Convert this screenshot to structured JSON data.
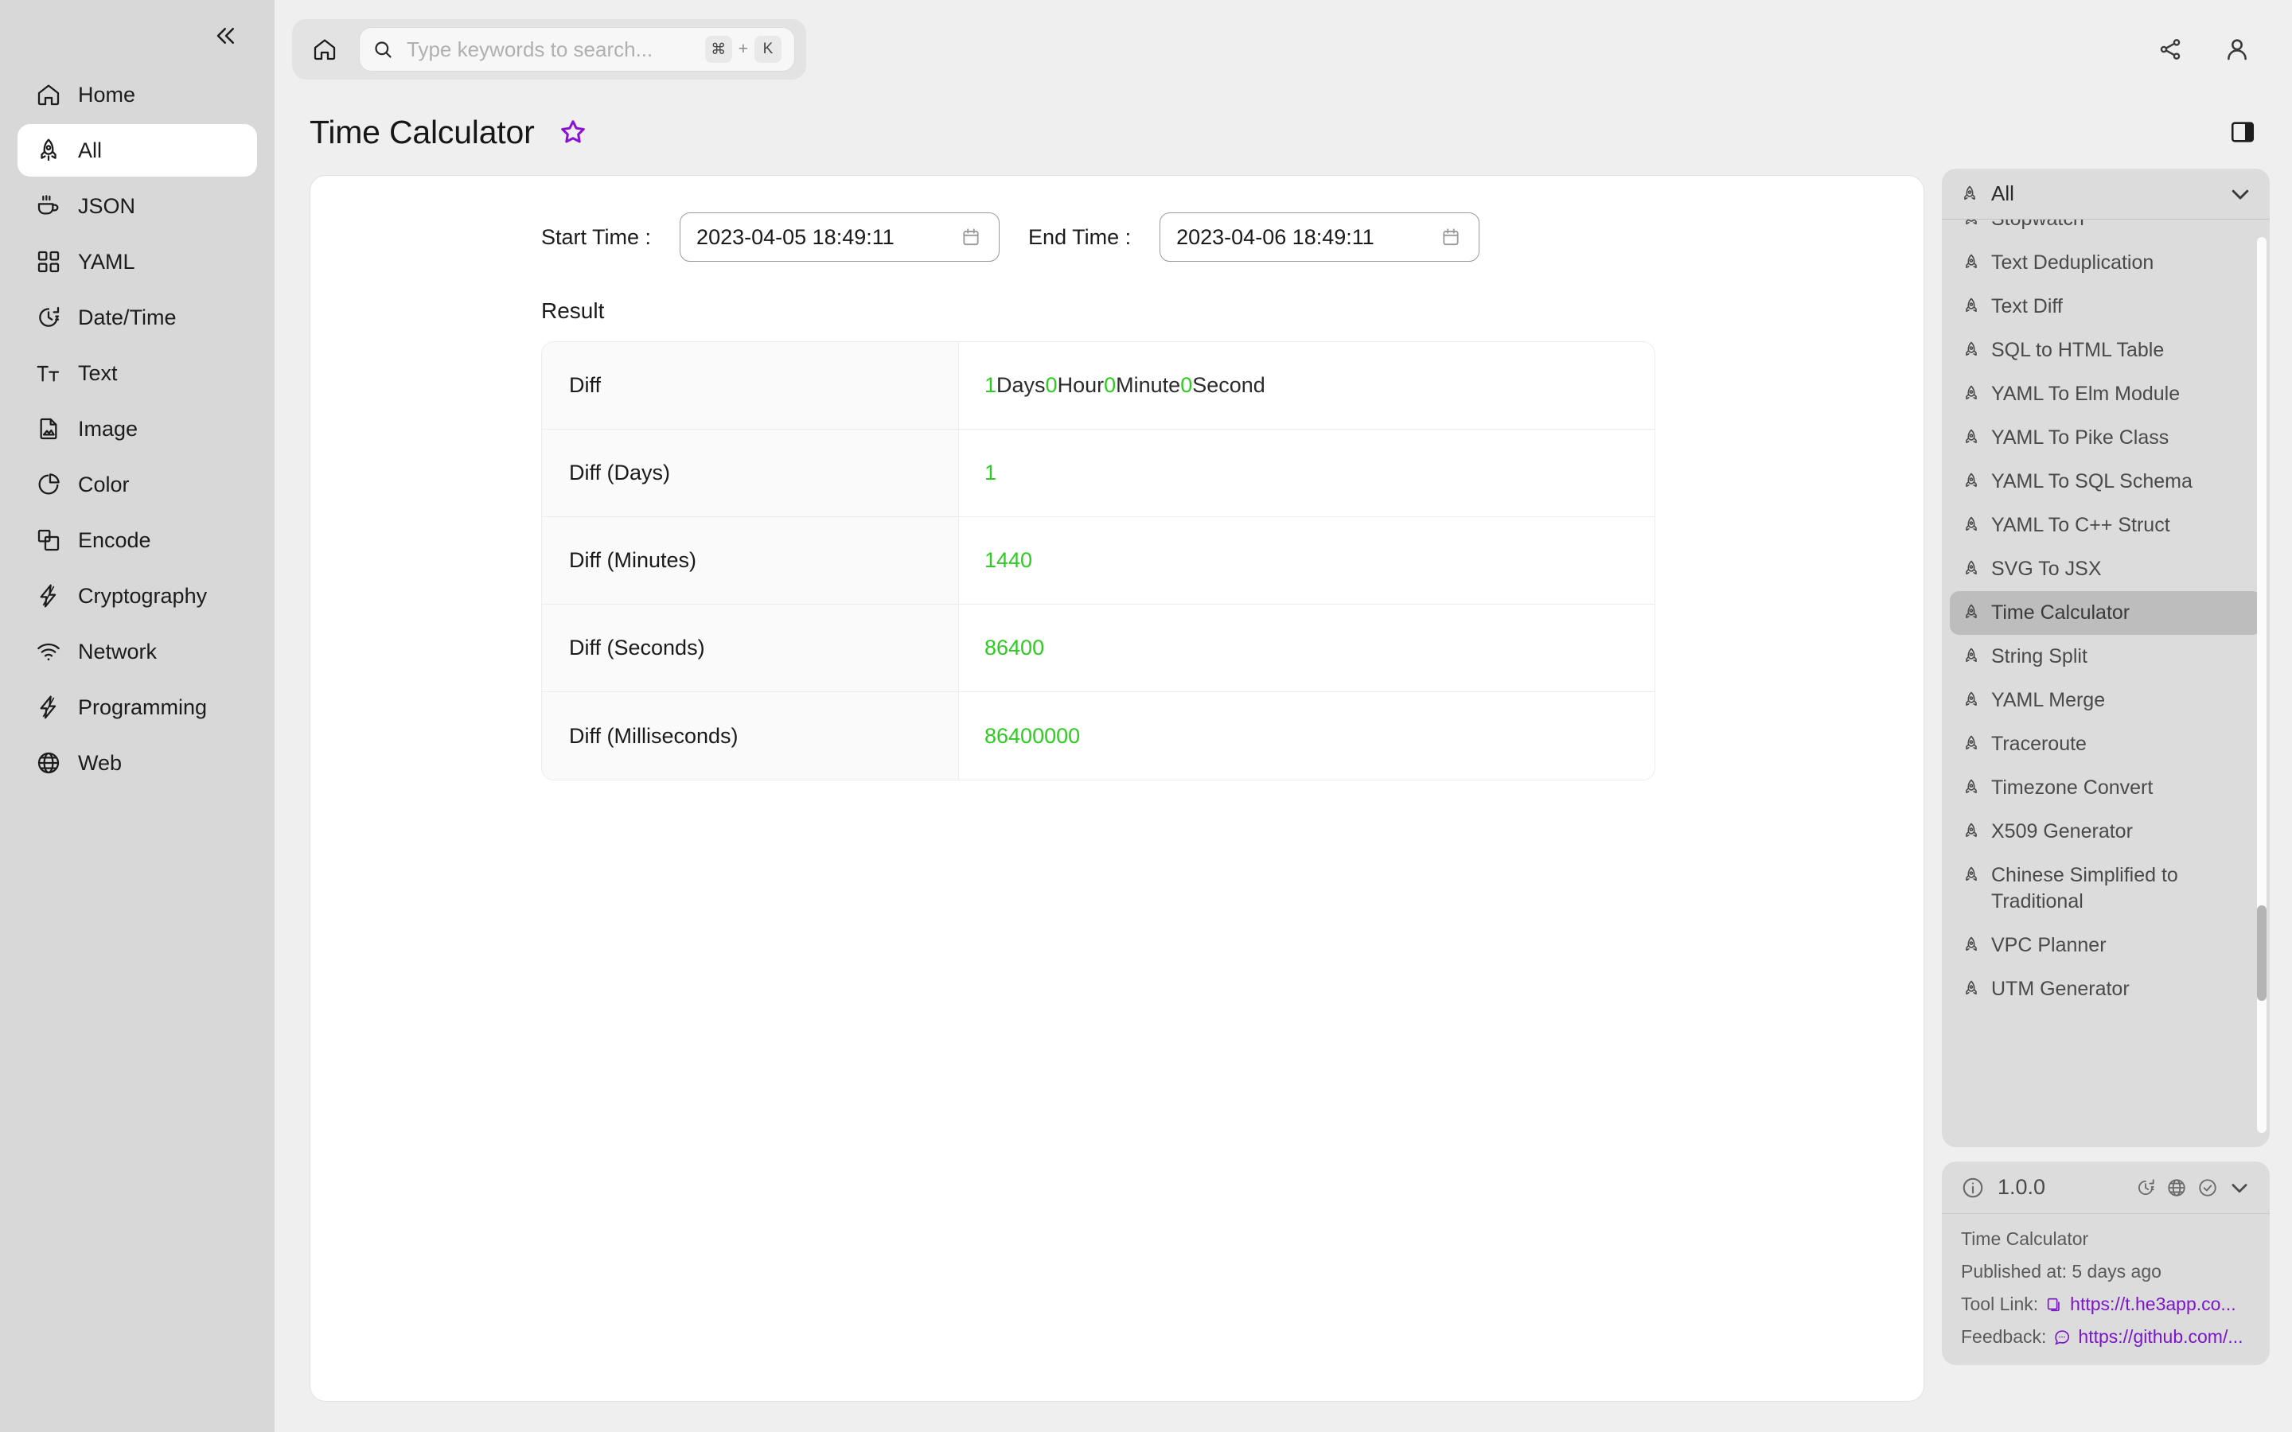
{
  "sidebar": {
    "collapse_icon": "chevron-double-left-icon",
    "items": [
      {
        "label": "Home",
        "icon": "home-icon",
        "active": false
      },
      {
        "label": "All",
        "icon": "rocket-icon",
        "active": true
      },
      {
        "label": "JSON",
        "icon": "coffee-cup-icon",
        "active": false
      },
      {
        "label": "YAML",
        "icon": "grid-squares-icon",
        "active": false
      },
      {
        "label": "Date/Time",
        "icon": "clock-arrow-icon",
        "active": false
      },
      {
        "label": "Text",
        "icon": "text-tt-icon",
        "active": false
      },
      {
        "label": "Image",
        "icon": "image-file-icon",
        "active": false
      },
      {
        "label": "Color",
        "icon": "pie-chart-icon",
        "active": false
      },
      {
        "label": "Encode",
        "icon": "layers-icon",
        "active": false
      },
      {
        "label": "Cryptography",
        "icon": "lightning-icon",
        "active": false
      },
      {
        "label": "Network",
        "icon": "wifi-icon",
        "active": false
      },
      {
        "label": "Programming",
        "icon": "lightning-icon",
        "active": false
      },
      {
        "label": "Web",
        "icon": "globe-icon",
        "active": false
      }
    ]
  },
  "topbar": {
    "home_icon": "home-icon",
    "search_icon": "search-icon",
    "search_placeholder": "Type keywords to search...",
    "search_value": "",
    "shortcut_keys": [
      "⌘",
      "+",
      "K"
    ],
    "share_icon": "share-icon",
    "account_icon": "user-account-icon"
  },
  "header": {
    "title": "Time Calculator",
    "favorite_icon": "star-outline-icon",
    "favorite_color": "#8b10d6",
    "panel_toggle_icon": "right-panel-toggle-icon"
  },
  "form": {
    "start_label": "Start Time :",
    "start_value": "2023-04-05 18:49:11",
    "end_label": "End Time :",
    "end_value": "2023-04-06 18:49:11",
    "calendar_icon": "calendar-icon"
  },
  "result": {
    "section_label": "Result",
    "accent_color": "#2ecc22",
    "rows": [
      {
        "key": "Diff",
        "parts": [
          {
            "text": "1",
            "kind": "num"
          },
          {
            "text": " Days ",
            "kind": "unit"
          },
          {
            "text": "0",
            "kind": "num"
          },
          {
            "text": " Hour ",
            "kind": "unit"
          },
          {
            "text": "0",
            "kind": "num"
          },
          {
            "text": " Minute ",
            "kind": "unit"
          },
          {
            "text": "0",
            "kind": "num"
          },
          {
            "text": " Second",
            "kind": "unit"
          }
        ]
      },
      {
        "key": "Diff (Days)",
        "parts": [
          {
            "text": "1",
            "kind": "num"
          }
        ]
      },
      {
        "key": "Diff (Minutes)",
        "parts": [
          {
            "text": "1440",
            "kind": "num"
          }
        ]
      },
      {
        "key": "Diff (Seconds)",
        "parts": [
          {
            "text": "86400",
            "kind": "num"
          }
        ]
      },
      {
        "key": "Diff (Milliseconds)",
        "parts": [
          {
            "text": "86400000",
            "kind": "num"
          }
        ]
      }
    ]
  },
  "tools_panel": {
    "filter_label": "All",
    "filter_icon": "rocket-icon",
    "chevron_icon": "chevron-down-icon",
    "items": [
      {
        "label": "Stopwatch",
        "selected": false,
        "clipped": true
      },
      {
        "label": "Text Deduplication",
        "selected": false
      },
      {
        "label": "Text Diff",
        "selected": false
      },
      {
        "label": "SQL to HTML Table",
        "selected": false
      },
      {
        "label": "YAML To Elm Module",
        "selected": false
      },
      {
        "label": "YAML To Pike Class",
        "selected": false
      },
      {
        "label": "YAML To SQL Schema",
        "selected": false
      },
      {
        "label": "YAML To C++ Struct",
        "selected": false
      },
      {
        "label": "SVG To JSX",
        "selected": false
      },
      {
        "label": "Time Calculator",
        "selected": true
      },
      {
        "label": "String Split",
        "selected": false
      },
      {
        "label": "YAML Merge",
        "selected": false
      },
      {
        "label": "Traceroute",
        "selected": false
      },
      {
        "label": "Timezone Convert",
        "selected": false
      },
      {
        "label": "X509 Generator",
        "selected": false
      },
      {
        "label": "Chinese Simplified to Traditional",
        "selected": false
      },
      {
        "label": "VPC Planner",
        "selected": false
      },
      {
        "label": "UTM Generator",
        "selected": false
      }
    ]
  },
  "info_panel": {
    "info_icon": "info-circle-icon",
    "version": "1.0.0",
    "action_icons": [
      "clock-arrow-icon",
      "globe-icon",
      "check-circle-icon",
      "chevron-down-icon"
    ],
    "tool_name": "Time Calculator",
    "published": "Published at: 5 days ago",
    "tool_link_label": "Tool Link:",
    "tool_link_icon": "copy-icon",
    "tool_link_value": "https://t.he3app.co...",
    "feedback_label": "Feedback:",
    "feedback_icon": "comment-icon",
    "feedback_value": "https://github.com/..."
  }
}
